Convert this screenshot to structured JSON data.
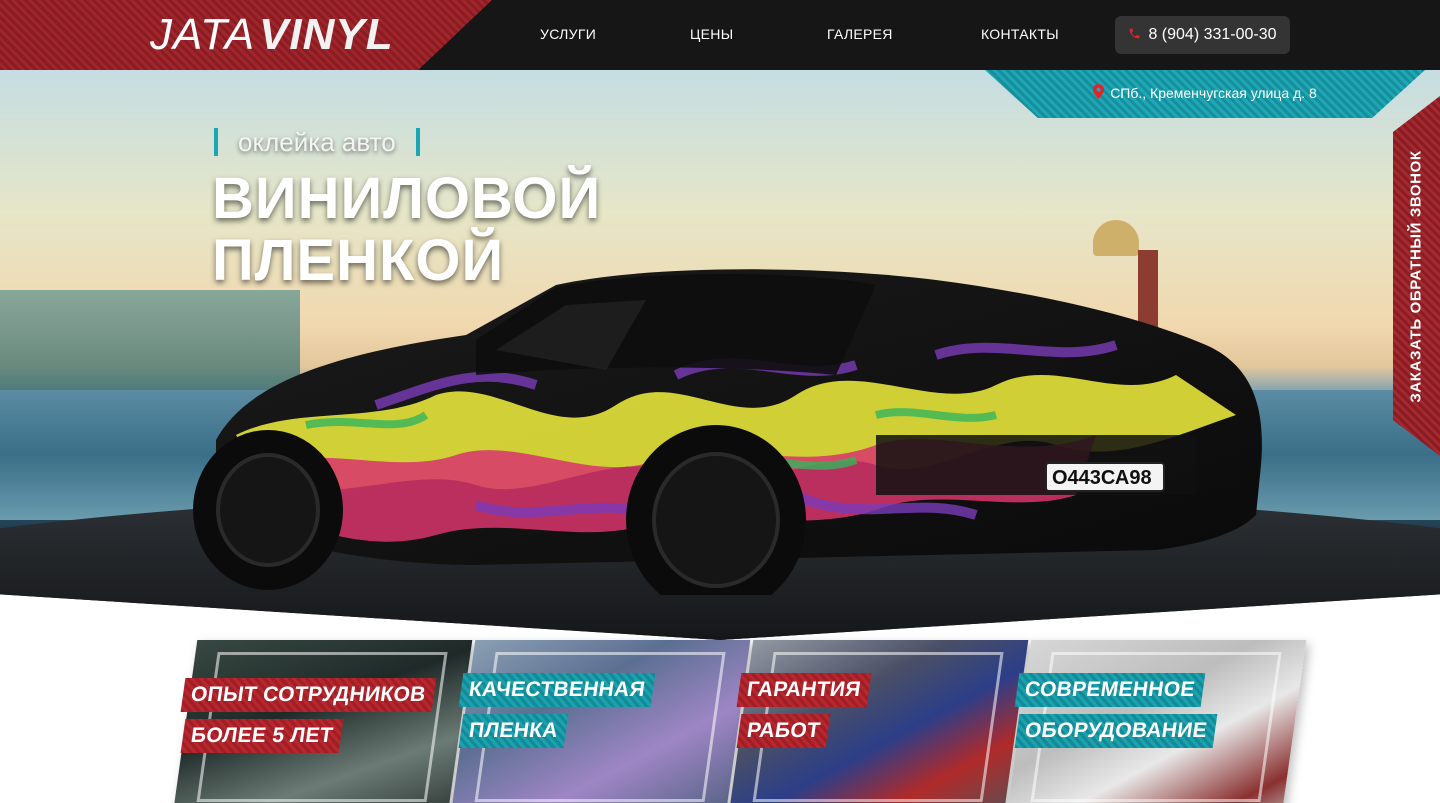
{
  "header": {
    "logo_part1": "JATA",
    "logo_part2": "VINYL",
    "nav": [
      {
        "label": "УСЛУГИ"
      },
      {
        "label": "ЦЕНЫ"
      },
      {
        "label": "ГАЛЕРЕЯ"
      },
      {
        "label": "КОНТАКТЫ"
      }
    ],
    "phone": "8 (904) 331-00-30",
    "phone_icon": "phone-icon"
  },
  "address": {
    "icon": "map-pin-icon",
    "text": "СПб., Кременчугская улица д. 8"
  },
  "hero": {
    "subtitle": "оклейка авто",
    "title_line1": "ВИНИЛОВОЙ",
    "title_line2": "ПЛЕНКОЙ",
    "plate": "О443СА98",
    "plate_region": "98"
  },
  "callback": {
    "label": "ЗАКАЗАТЬ ОБРАТНЫЙ ЗВОНОК"
  },
  "features": [
    {
      "line1": "ОПЫТ СОТРУДНИКОВ",
      "line2": "БОЛЕЕ 5 ЛЕТ",
      "color": "red"
    },
    {
      "line1": "КАЧЕСТВЕННАЯ",
      "line2": "ПЛЕНКА",
      "color": "teal"
    },
    {
      "line1": "ГАРАНТИЯ",
      "line2": "РАБОТ",
      "color": "red"
    },
    {
      "line1": "СОВРЕМЕННОЕ",
      "line2": "ОБОРУДОВАНИЕ",
      "color": "teal"
    }
  ],
  "colors": {
    "brand_red": "#9f262c",
    "brand_teal": "#1ea7b5",
    "header_bg": "#161616"
  }
}
